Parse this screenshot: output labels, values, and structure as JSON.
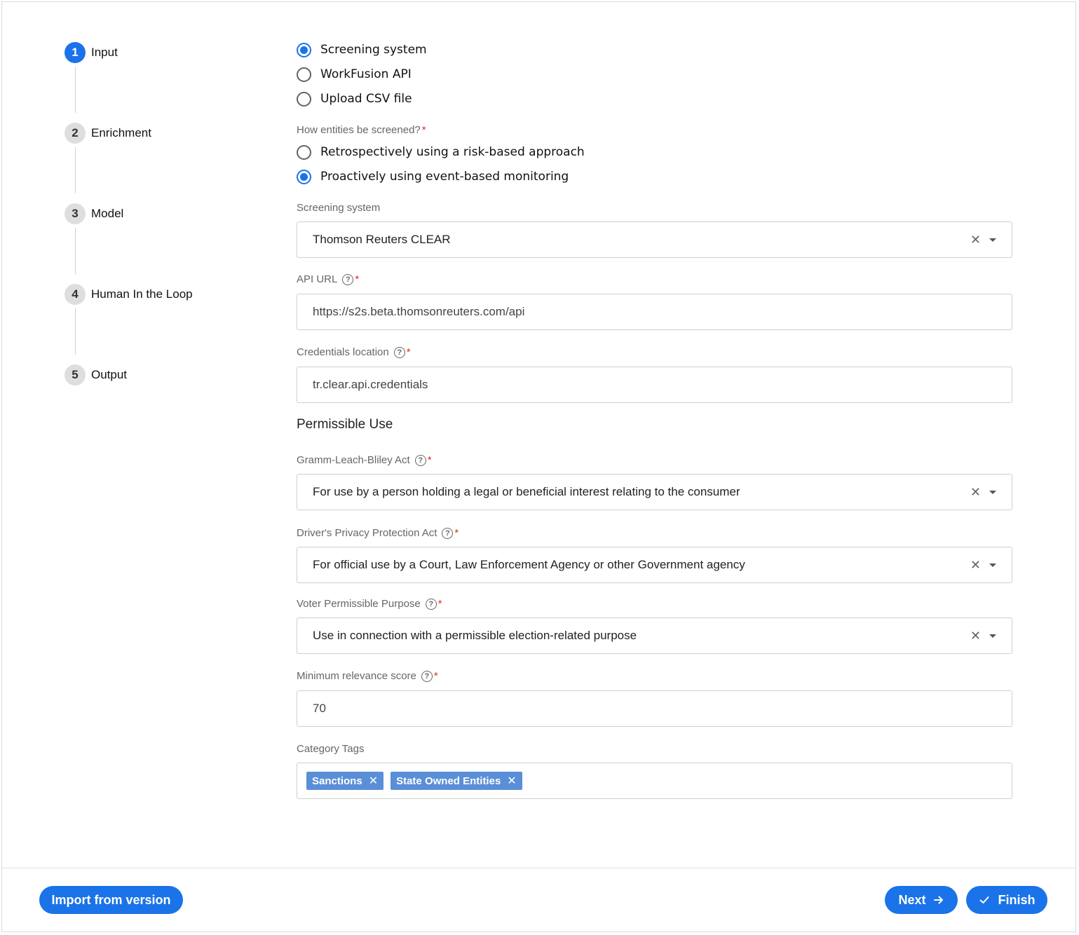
{
  "stepper": {
    "steps": [
      {
        "number": "1",
        "label": "Input"
      },
      {
        "number": "2",
        "label": "Enrichment"
      },
      {
        "number": "3",
        "label": "Model"
      },
      {
        "number": "4",
        "label": "Human In the Loop"
      },
      {
        "number": "5",
        "label": "Output"
      }
    ]
  },
  "source": {
    "options": [
      "Screening system",
      "WorkFusion API",
      "Upload CSV file"
    ],
    "selected": "Screening system"
  },
  "screening_mode": {
    "label": "How entities be screened?",
    "options": [
      "Retrospectively using a risk-based approach",
      "Proactively using event-based monitoring"
    ],
    "selected": "Proactively using event-based monitoring"
  },
  "screening_system": {
    "label": "Screening system",
    "value": "Thomson Reuters CLEAR"
  },
  "api_url": {
    "label": "API URL",
    "value": "https://s2s.beta.thomsonreuters.com/api"
  },
  "credentials": {
    "label": "Credentials location",
    "value": "tr.clear.api.credentials"
  },
  "permissible_use": {
    "title": "Permissible Use",
    "glba": {
      "label": "Gramm-Leach-Bliley Act",
      "value": "For use by a person holding a legal or beneficial interest relating to the consumer"
    },
    "dppa": {
      "label": "Driver's Privacy Protection Act",
      "value": "For official use by a Court, Law Enforcement Agency or other Government agency"
    },
    "voter": {
      "label": "Voter Permissible Purpose",
      "value": "Use in connection with a permissible election-related purpose"
    }
  },
  "min_relevance": {
    "label": "Minimum relevance score",
    "value": "70"
  },
  "category_tags": {
    "label": "Category Tags",
    "tags": [
      "Sanctions",
      "State Owned Entities"
    ]
  },
  "footer": {
    "import_label": "Import from version",
    "next_label": "Next",
    "finish_label": "Finish"
  },
  "icons": {
    "help": "help-circle-icon",
    "clear": "close-icon",
    "dropdown": "caret-down-icon",
    "next": "arrow-right-icon",
    "finish": "check-icon"
  },
  "colors": {
    "primary": "#1a73e8",
    "tag": "#5a8fd8",
    "required": "#d93025"
  }
}
